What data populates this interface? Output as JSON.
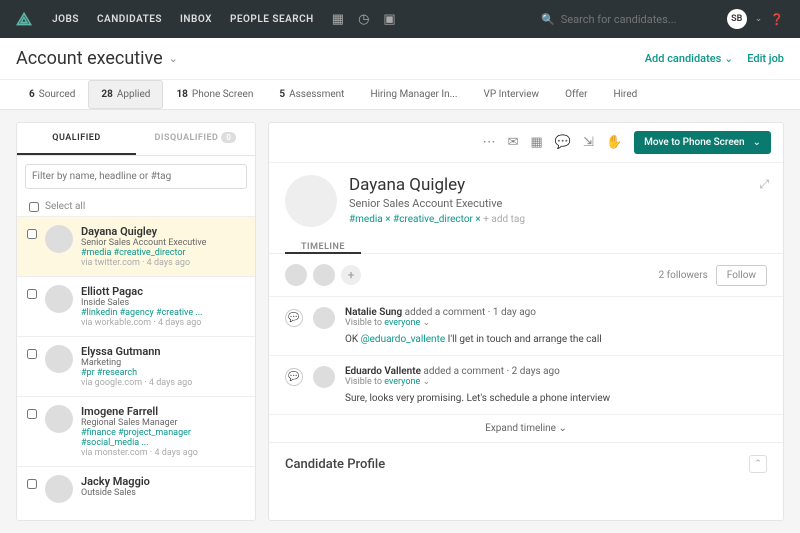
{
  "nav": {
    "links": [
      "JOBS",
      "CANDIDATES",
      "INBOX",
      "PEOPLE SEARCH"
    ],
    "search_placeholder": "Search for candidates...",
    "user_initials": "SB"
  },
  "page": {
    "title": "Account executive",
    "add_candidates": "Add candidates",
    "edit_job": "Edit job"
  },
  "stages": [
    {
      "count": "6",
      "label": "Sourced"
    },
    {
      "count": "28",
      "label": "Applied",
      "active": true
    },
    {
      "count": "18",
      "label": "Phone Screen"
    },
    {
      "count": "5",
      "label": "Assessment"
    },
    {
      "count": "",
      "label": "Hiring Manager In..."
    },
    {
      "count": "",
      "label": "VP Interview"
    },
    {
      "count": "",
      "label": "Offer"
    },
    {
      "count": "",
      "label": "Hired"
    }
  ],
  "left": {
    "tab_qualified": "QUALIFIED",
    "tab_disqualified": "DISQUALIFIED",
    "disq_count": "0",
    "filter_placeholder": "Filter by name, headline or #tag",
    "select_all": "Select all",
    "candidates": [
      {
        "name": "Dayana Quigley",
        "title": "Senior Sales Account Executive",
        "tags": "#media #creative_director",
        "meta": "via twitter.com · 4 days ago",
        "selected": true
      },
      {
        "name": "Elliott Pagac",
        "title": "Inside Sales",
        "tags": "#linkedin #agency #creative ...",
        "meta": "via workable.com · 4 days ago"
      },
      {
        "name": "Elyssa Gutmann",
        "title": "Marketing",
        "tags": "#pr #research",
        "meta": "via google.com · 4 days ago"
      },
      {
        "name": "Imogene Farrell",
        "title": "Regional Sales Manager",
        "tags": "#finance #project_manager #social_media ...",
        "meta": "via monster.com · 4 days ago"
      },
      {
        "name": "Jacky Maggio",
        "title": "Outside Sales",
        "tags": "",
        "meta": ""
      }
    ]
  },
  "detail": {
    "move_btn": "Move to Phone Screen",
    "name": "Dayana Quigley",
    "title": "Senior Sales Account Executive",
    "tags": "#media × #creative_director ×",
    "add_tag": "+ add tag",
    "timeline_label": "TIMELINE",
    "followers_count": "2 followers",
    "follow_btn": "Follow",
    "items": [
      {
        "author": "Natalie Sung",
        "action": "added a comment",
        "time": "1 day ago",
        "visibility": "everyone",
        "text_pre": "OK ",
        "mention": "@eduardo_vallente",
        "text_post": " I'll get in touch and arrange the call"
      },
      {
        "author": "Eduardo Vallente",
        "action": "added a comment",
        "time": "2 days ago",
        "visibility": "everyone",
        "text_pre": "Sure, looks very promising. Let's schedule a phone interview",
        "mention": "",
        "text_post": ""
      }
    ],
    "expand": "Expand timeline",
    "profile_section": "Candidate Profile"
  }
}
